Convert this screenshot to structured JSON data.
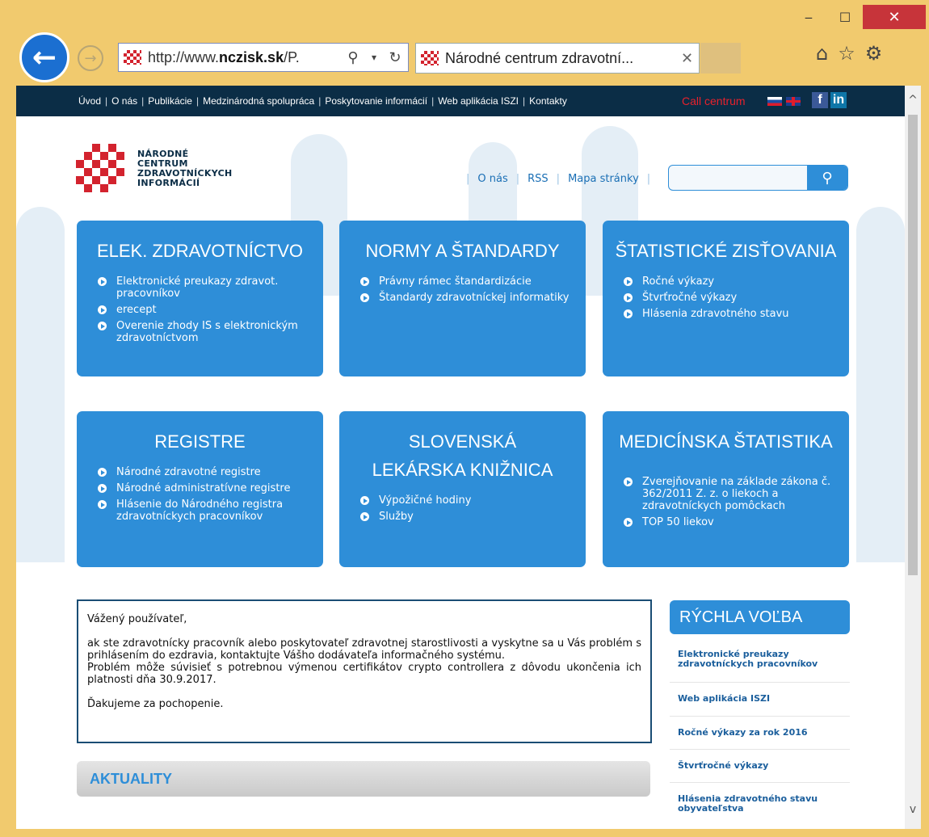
{
  "window": {
    "minimize": "‒",
    "maximize": "☐",
    "close": "✕"
  },
  "browser": {
    "url_prefix": "http://www.",
    "url_domain": "nczisk.sk",
    "url_suffix": "/P.",
    "tab_title": "Národné centrum zdravotní...",
    "tab_close": "✕"
  },
  "topnav": {
    "links": [
      "Úvod",
      "O nás",
      "Publikácie",
      "Medzinárodná spolupráca",
      "Poskytovanie informácií",
      "Web aplikácia ISZI",
      "Kontakty"
    ],
    "separator": "|",
    "call_centrum": "Call centrum",
    "facebook": "f",
    "linkedin": "in"
  },
  "logo": {
    "line1": "NÁRODNÉ",
    "line2": "CENTRUM",
    "line3": "ZDRAVOTNÍCKYCH",
    "line4": "INFORMÁCIÍ"
  },
  "midlinks": {
    "o_nas": "O nás",
    "rss": "RSS",
    "mapa": "Mapa stránky"
  },
  "search": {
    "placeholder": ""
  },
  "tiles": [
    {
      "title": "ELEK. ZDRAVOTNÍCTVO",
      "items": [
        "Elektronické preukazy zdravot. pracovníkov",
        "erecept",
        "Overenie zhody IS s elektronickým zdravotníctvom"
      ]
    },
    {
      "title": "NORMY A ŠTANDARDY",
      "items": [
        "Právny rámec štandardizácie",
        "Štandardy zdravotníckej informatiky"
      ]
    },
    {
      "title": "ŠTATISTICKÉ ZISŤOVANIA",
      "items": [
        "Ročné výkazy",
        "Štvrťročné výkazy",
        "Hlásenia zdravotného stavu"
      ]
    },
    {
      "title": "REGISTRE",
      "items": [
        "Národné zdravotné registre",
        "Národné administratívne registre",
        "Hlásenie do Národného registra zdravotníckych pracovníkov"
      ]
    },
    {
      "title_line1": "SLOVENSKÁ",
      "title_line2": "LEKÁRSKA KNIŽNICA",
      "items": [
        "Výpožičné hodiny",
        "Služby"
      ]
    },
    {
      "title": "MEDICÍNSKA ŠTATISTIKA",
      "items": [
        "Zverejňovanie na základe zákona č. 362/2011 Z. z. o liekoch a zdravotníckych pomôckach",
        "TOP 50 liekov"
      ]
    }
  ],
  "notice": {
    "greeting": "Vážený používateľ,",
    "body1": "ak ste zdravotnícky pracovník alebo poskytovateľ zdravotnej starostlivosti a vyskytne sa u Vás problém s prihlásením do ezdravia, kontaktujte Vášho dodávateľa informačného systému.",
    "body2": "Problém môže súvisieť s potrebnou výmenou certifikátov crypto controllera z dôvodu ukončenia ich platnosti dňa 30.9.2017.",
    "thanks": "Ďakujeme za pochopenie."
  },
  "aktuality": "AKTUALITY",
  "rychla_volba": {
    "title": "RÝCHLA VOĽBA",
    "items": [
      "Elektronické preukazy zdravotníckych pracovníkov",
      "Web aplikácia ISZI",
      "Ročné výkazy za rok 2016",
      "Štvrťročné výkazy",
      "Hlásenia zdravotného stavu obyvateľstva"
    ]
  }
}
